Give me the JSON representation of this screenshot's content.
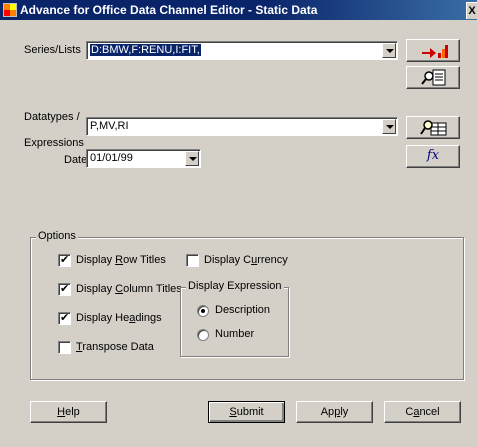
{
  "window": {
    "title": "Advance for Office Data Channel Editor - Static Data",
    "close": "X"
  },
  "series": {
    "label": "Series/Lists",
    "value": "D:BMW,F:RENU,I:FIT,"
  },
  "datatypes": {
    "label1": "Datatypes /",
    "label2": "Expressions",
    "value": "P,MV,RI"
  },
  "date": {
    "label": "Date",
    "value": "01/01/99"
  },
  "options": {
    "group_label": "Options",
    "display_row_titles": {
      "pre": "Display ",
      "key": "R",
      "post": "ow Titles",
      "checked": true
    },
    "display_column_titles": {
      "pre": "Display ",
      "key": "C",
      "post": "olumn Titles",
      "checked": true
    },
    "display_headings": {
      "pre": "Display He",
      "key": "a",
      "post": "dings",
      "checked": true
    },
    "transpose_data": {
      "pre": "",
      "key": "T",
      "post": "ranspose Data",
      "checked": false
    },
    "display_currency": {
      "pre": "Display C",
      "key": "u",
      "post": "rrency",
      "checked": false
    },
    "display_expression": {
      "label": "Display Expression",
      "description": "Description",
      "number": "Number",
      "selected": "Description"
    }
  },
  "buttons": {
    "help": {
      "key": "H",
      "rest": "elp"
    },
    "submit": {
      "key": "S",
      "rest": "ubmit"
    },
    "apply": {
      "pre": "Ap",
      "key": "p",
      "post": "ly"
    },
    "cancel": {
      "pre": "C",
      "key": "a",
      "post": "ncel"
    },
    "fx": "fx"
  },
  "icons": [
    "app-icon",
    "export-chart-icon",
    "search-list-icon",
    "find-datatype-icon",
    "function-icon"
  ]
}
